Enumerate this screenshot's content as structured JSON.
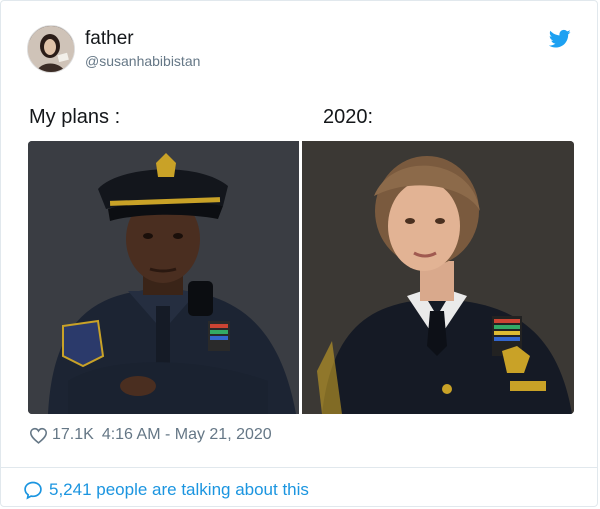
{
  "tweet": {
    "display_name": "father",
    "handle": "@susanhabibistan",
    "text_left": "My plans :",
    "text_right": "2020:",
    "likes": "17.1K",
    "timestamp": "4:16 AM - May 21, 2020",
    "talking": "5,241 people are talking about this"
  },
  "icons": {
    "brand": "twitter-bird-icon",
    "like": "heart-icon",
    "reply": "speech-bubble-icon"
  },
  "colors": {
    "brand": "#1da1f2",
    "link": "#1b95e0",
    "muted": "#657786"
  }
}
